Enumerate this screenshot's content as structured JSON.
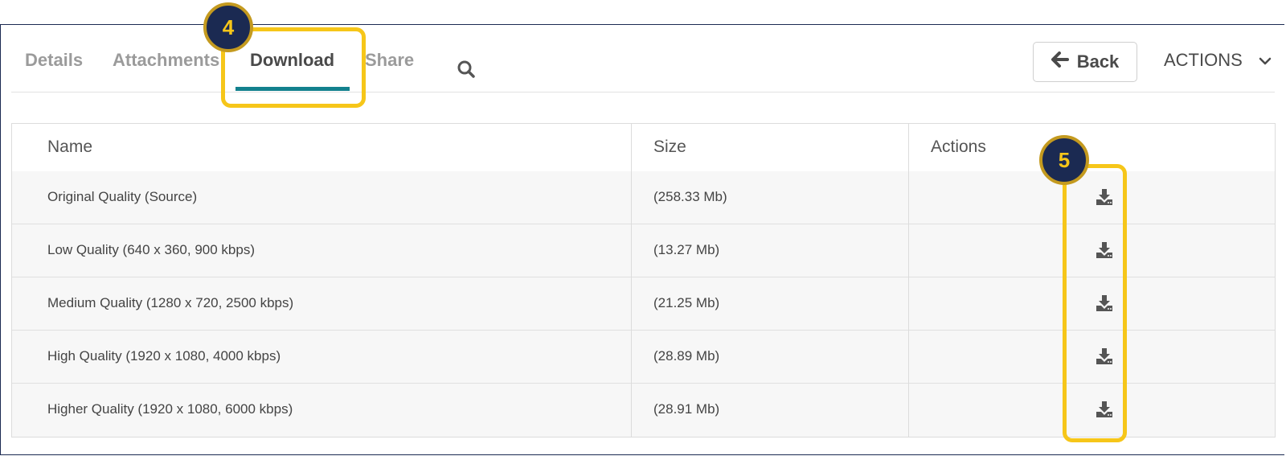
{
  "tabs": [
    {
      "label": "Details"
    },
    {
      "label": "Attachments"
    },
    {
      "label": "Download"
    },
    {
      "label": "Share"
    }
  ],
  "header": {
    "back_label": "Back",
    "actions_label": "ACTIONS"
  },
  "table": {
    "columns": [
      "Name",
      "Size",
      "Actions"
    ],
    "rows": [
      {
        "name": "Original Quality (Source)",
        "size": "(258.33 Mb)"
      },
      {
        "name": "Low Quality (640 x 360, 900 kbps)",
        "size": "(13.27 Mb)"
      },
      {
        "name": "Medium Quality (1280 x 720, 2500 kbps)",
        "size": "(21.25 Mb)"
      },
      {
        "name": "High Quality (1920 x 1080, 4000 kbps)",
        "size": "(28.89 Mb)"
      },
      {
        "name": "Higher Quality (1920 x 1080, 6000 kbps)",
        "size": "(28.91 Mb)"
      }
    ]
  },
  "callouts": [
    {
      "number": "4"
    },
    {
      "number": "5"
    }
  ],
  "colors": {
    "accent_underline": "#13818e",
    "highlight": "#f6c619",
    "badge_bg": "#1b2a52"
  }
}
